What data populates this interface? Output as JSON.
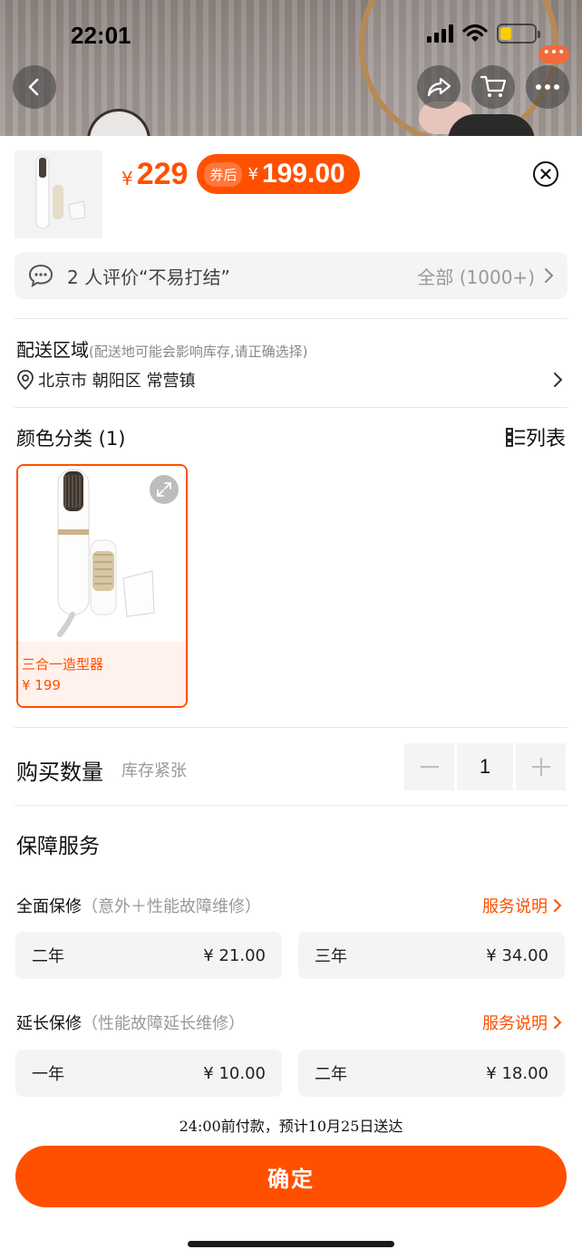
{
  "status_bar": {
    "time": "22:01",
    "colors": {
      "battery_fill": "#f6cd0a"
    },
    "battery_level": 0.34
  },
  "top_actions": {
    "back_icon": "chevron-left-icon",
    "share_icon": "share-icon",
    "cart_icon": "cart-icon",
    "more_icon": "more-dots-icon",
    "more_badge": "•••"
  },
  "product": {
    "price_currency": "¥",
    "price": "229",
    "coupon_label": "券后",
    "coupon_currency": "¥",
    "coupon_price": "199.00"
  },
  "review": {
    "count_text": "2 人评价“不易打结”",
    "all_text": "全部 (1000+)"
  },
  "delivery": {
    "title": "配送区域",
    "note": "(配送地可能会影响库存,请正确选择)",
    "address": "北京市 朝阳区 常营镇"
  },
  "color_section": {
    "title": "颜色分类 (1)",
    "list_label": "列表",
    "options": [
      {
        "name": "三合一造型器",
        "price": "¥ 199"
      }
    ]
  },
  "quantity": {
    "title": "购买数量",
    "stock": "库存紧张",
    "value": "1"
  },
  "service": {
    "title": "保障服务",
    "groups": [
      {
        "label": "全面保修",
        "sub": "（意外＋性能故障维修）",
        "link": "服务说明",
        "options": [
          {
            "name": "二年",
            "price": "¥ 21.00"
          },
          {
            "name": "三年",
            "price": "¥ 34.00"
          }
        ]
      },
      {
        "label": "延长保修",
        "sub": "（性能故障延长维修）",
        "link": "服务说明",
        "options": [
          {
            "name": "一年",
            "price": "¥ 10.00"
          },
          {
            "name": "二年",
            "price": "¥ 18.00"
          }
        ]
      }
    ]
  },
  "eta": "24:00前付款，预计10月25日送达",
  "confirm_label": "确定",
  "colors": {
    "accent": "#ff5000",
    "sheet_bg": "#ffffff",
    "chip_bg": "#f4f4f4"
  }
}
